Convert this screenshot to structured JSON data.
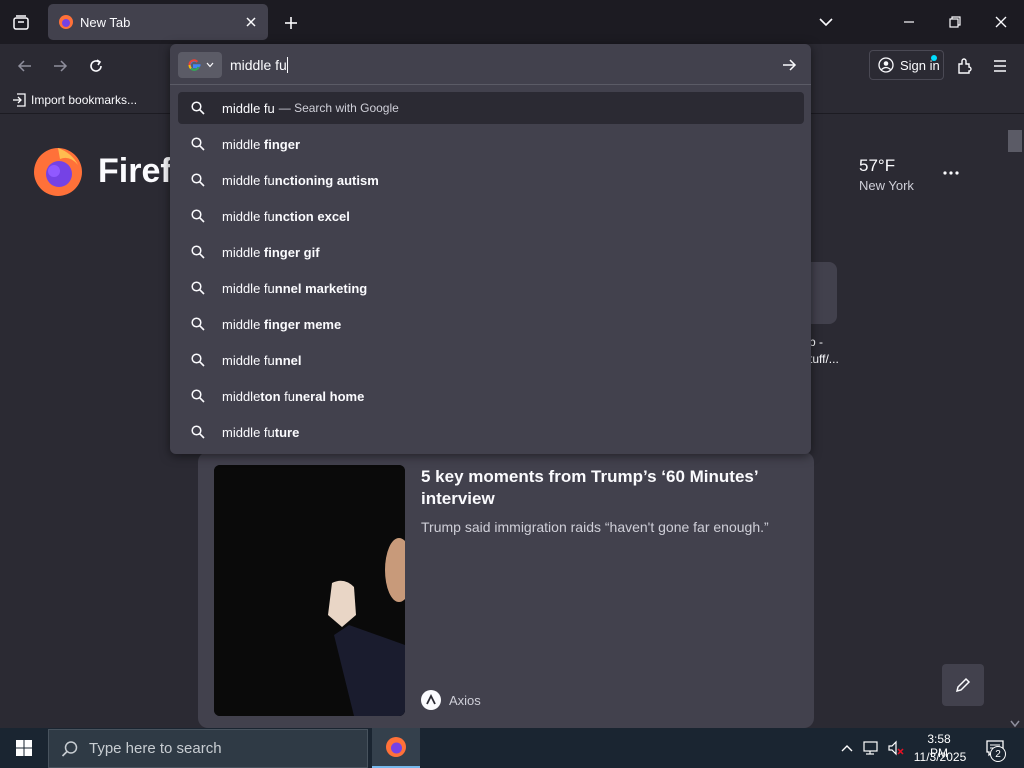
{
  "colors": {
    "tab_strip_bg": "#1c1b22",
    "toolbar_bg": "#2b2a33",
    "popup_bg": "#42414d",
    "text": "#fbfbfe",
    "taskbar_bg": "#1a2531"
  },
  "tabs": [
    {
      "label": "New Tab",
      "icon": "firefox-icon",
      "active": true
    }
  ],
  "toolbar": {
    "signin_label": "Sign in",
    "icons": [
      "back-arrow-icon",
      "forward-arrow-icon",
      "reload-icon",
      "account-icon",
      "extensions-icon",
      "menu-icon"
    ]
  },
  "bookmarks": {
    "import_label": "Import bookmarks..."
  },
  "urlbar": {
    "value": "middle fu",
    "engine_icon": "google-icon",
    "suggestions": [
      {
        "parts": [
          {
            "text": "middle fu",
            "bold": false
          }
        ],
        "action": "— Search with Google",
        "selected": true
      },
      {
        "parts": [
          {
            "text": "middle ",
            "bold": false
          },
          {
            "text": "finger",
            "bold": true
          }
        ]
      },
      {
        "parts": [
          {
            "text": "middle fu",
            "bold": false
          },
          {
            "text": "nctioning autism",
            "bold": true
          }
        ]
      },
      {
        "parts": [
          {
            "text": "middle fu",
            "bold": false
          },
          {
            "text": "nction excel",
            "bold": true
          }
        ]
      },
      {
        "parts": [
          {
            "text": "middle ",
            "bold": false
          },
          {
            "text": "finger gif",
            "bold": true
          }
        ]
      },
      {
        "parts": [
          {
            "text": "middle fu",
            "bold": false
          },
          {
            "text": "nnel marketing",
            "bold": true
          }
        ]
      },
      {
        "parts": [
          {
            "text": "middle ",
            "bold": false
          },
          {
            "text": "finger meme",
            "bold": true
          }
        ]
      },
      {
        "parts": [
          {
            "text": "middle fu",
            "bold": false
          },
          {
            "text": "nnel",
            "bold": true
          }
        ]
      },
      {
        "parts": [
          {
            "text": "middle",
            "bold": false
          },
          {
            "text": "ton ",
            "bold": true
          },
          {
            "text": "fu",
            "bold": false
          },
          {
            "text": "neral home",
            "bold": true
          }
        ]
      },
      {
        "parts": [
          {
            "text": "middle fu",
            "bold": false
          },
          {
            "text": "ture",
            "bold": true
          }
        ]
      }
    ]
  },
  "newtab": {
    "brand_name": "Firefox",
    "weather": {
      "temp": "57°F",
      "city": "New York"
    },
    "shortcut": {
      "title_line1": "b -",
      "title_line2": "tuff/..."
    },
    "story": {
      "title": "5 key moments from Trump’s ‘60 Minutes’ interview",
      "excerpt": "Trump said immigration raids “haven't gone far enough.”",
      "source": "Axios"
    }
  },
  "taskbar": {
    "search_placeholder": "Type here to search",
    "time": "3:58 PM",
    "date": "11/3/2025",
    "notification_count": "2"
  }
}
